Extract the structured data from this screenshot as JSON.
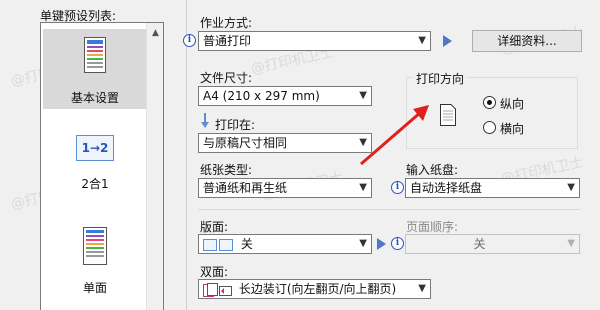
{
  "presets": {
    "title": "单键预设列表:",
    "items": [
      {
        "label": "基本设置",
        "selected": true
      },
      {
        "label": "2合1",
        "icon_text": "1→2"
      },
      {
        "label": "单面"
      }
    ]
  },
  "job_mode": {
    "label": "作业方式:",
    "value": "普通打印",
    "details_button": "详细资料..."
  },
  "paper_size": {
    "label": "文件尺寸:",
    "value": "A4 (210 x 297 mm)"
  },
  "print_on": {
    "label": "打印在:",
    "value": "与原稿尺寸相同"
  },
  "orientation": {
    "title": "打印方向",
    "options": [
      {
        "label": "纵向",
        "checked": true
      },
      {
        "label": "横向",
        "checked": false
      }
    ]
  },
  "paper_type": {
    "label": "纸张类型:",
    "value": "普通纸和再生纸"
  },
  "input_tray": {
    "label": "输入纸盘:",
    "value": "自动选择纸盘"
  },
  "layout": {
    "label": "版面:",
    "value": "关"
  },
  "page_order": {
    "label": "页面顺序:",
    "value": "关"
  },
  "duplex": {
    "label": "双面:",
    "value": "长边装订(向左翻页/向上翻页)"
  },
  "watermark_text": "@打印机卫士",
  "colors": {
    "accent": "#4d79c7",
    "arrow": "#e0201b"
  }
}
